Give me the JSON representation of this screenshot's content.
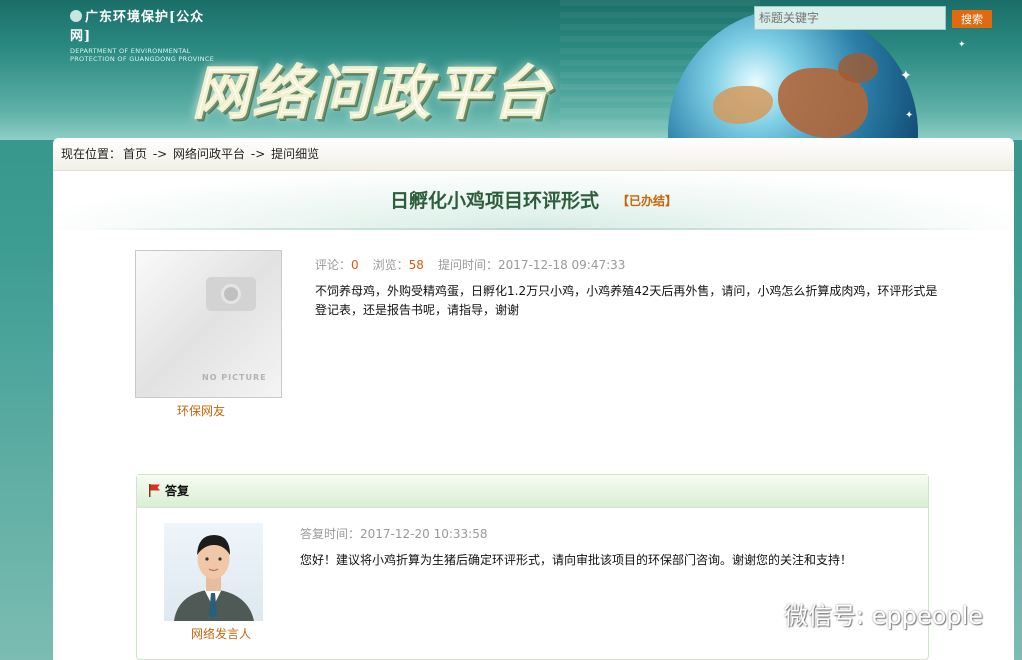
{
  "header": {
    "brand_cn": "广东环境保护[公众网]",
    "brand_en_1": "DEPARTMENT OF ENVIRONMENTAL",
    "brand_en_2": "PROTECTION OF GUANGDONG PROVINCE",
    "platform_title": "网络问政平台"
  },
  "search": {
    "placeholder": "标题关键字",
    "button_label": "搜索"
  },
  "breadcrumb": {
    "prefix": "现在位置：",
    "home": "首页",
    "sep1": " -> ",
    "section": "网络问政平台",
    "sep2": " -> ",
    "current": "提问细览"
  },
  "question": {
    "title": "日孵化小鸡项目环评形式",
    "status": "【已办结】",
    "comments_label": "评论：",
    "comments": "0",
    "views_label": "浏览：",
    "views": "58",
    "time_label": "提问时间：",
    "time": "2017-12-18 09:47:33",
    "body": "不饲养母鸡，外购受精鸡蛋，日孵化1.2万只小鸡，小鸡养殖42天后再外售，请问，小鸡怎么折算成肉鸡，环评形式是登记表，还是报告书呢，请指导，谢谢",
    "asker": "环保网友",
    "no_picture": "NO PICTURE"
  },
  "reply": {
    "heading": "答复",
    "time_label": "答复时间：",
    "time": "2017-12-20 10:33:58",
    "body": "您好！建议将小鸡折算为生猪后确定环评形式，请向审批该项目的环保部门咨询。谢谢您的关注和支持！",
    "speaker": "网络发言人"
  },
  "watermark": {
    "text": "微信号: eppeople"
  },
  "colors": {
    "accent_orange": "#e06a10",
    "title_green": "#2c5e3c",
    "link_orange": "#c8650a"
  }
}
